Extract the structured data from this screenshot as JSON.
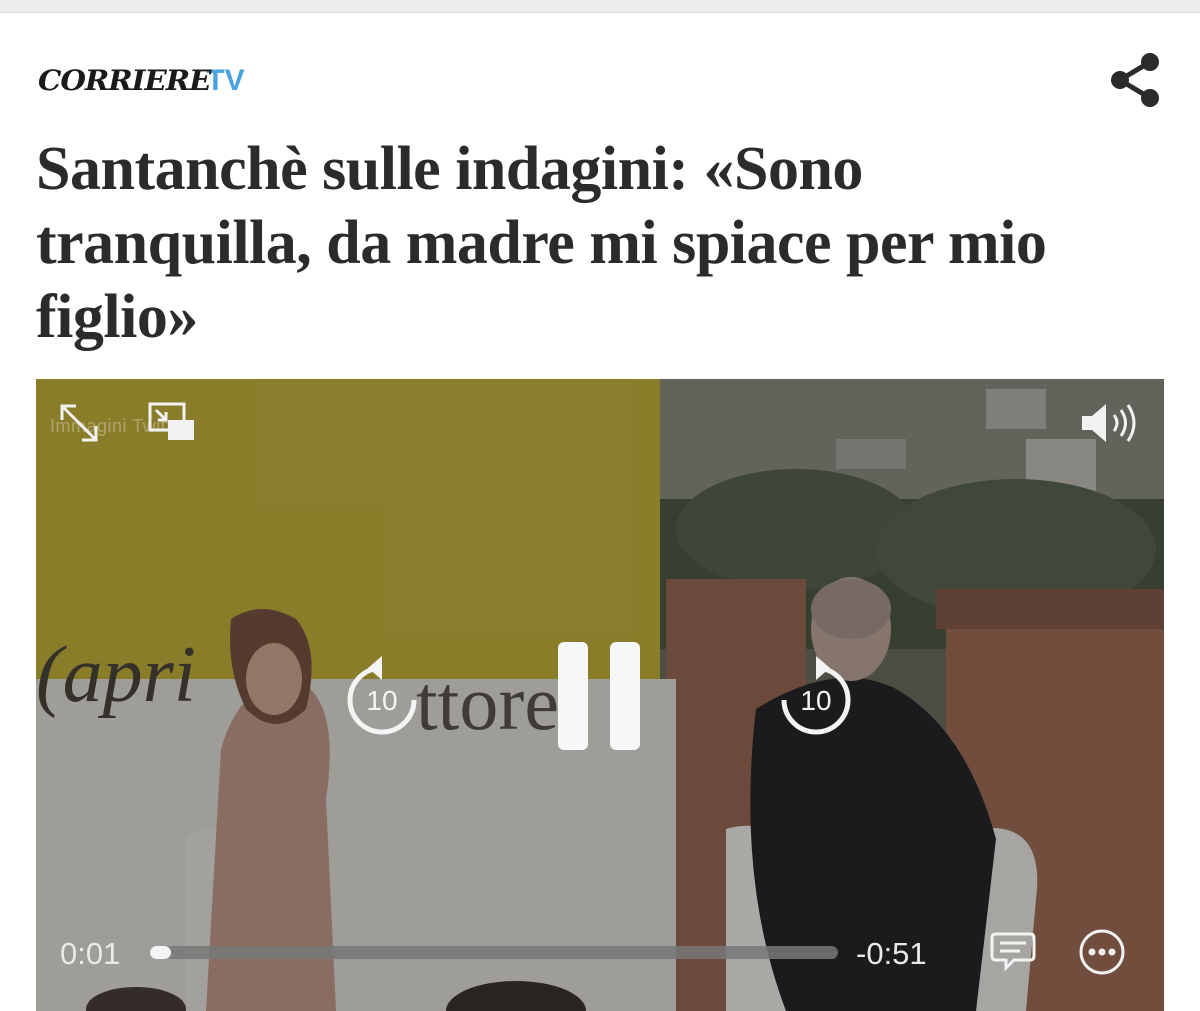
{
  "header": {
    "logo_main": "CORRIERE",
    "logo_tv": "TV",
    "share_icon": "share-icon"
  },
  "article": {
    "headline": "Santanchè sulle indagini: «Sono tranquilla, da madre mi spiace per mio figlio»"
  },
  "player": {
    "watermark": "Immagini Twitter",
    "scene_text_left": "(apri",
    "scene_text_mid": "ttore",
    "skip_back_label": "10",
    "skip_forward_label": "10",
    "elapsed": "0:01",
    "remaining": "-0:51",
    "progress_fraction": 0.02,
    "icons": [
      "fullscreen-icon",
      "picture-in-picture-icon",
      "volume-icon",
      "skip-back-icon",
      "pause-icon",
      "skip-forward-icon",
      "subtitles-icon",
      "more-icon"
    ]
  },
  "colors": {
    "brand_blue": "#4aa3df",
    "headline": "#2b2b2b",
    "banner_yellow": "#b9a52c"
  }
}
